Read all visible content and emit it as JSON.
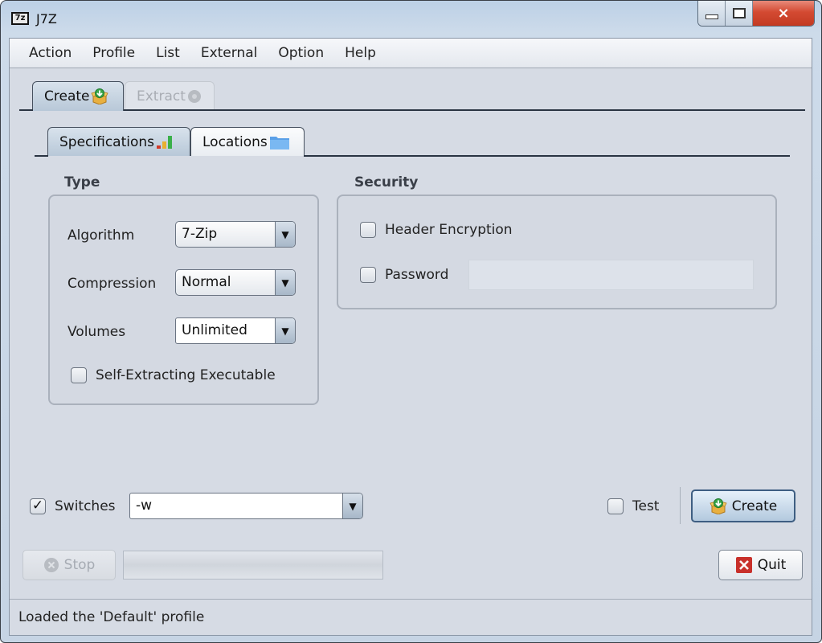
{
  "window": {
    "title": "J7Z",
    "app_icon_text": "7z",
    "controls": {
      "minimize": "minimize-icon",
      "maximize": "maximize-icon",
      "close": "×"
    }
  },
  "menubar": {
    "items": [
      {
        "label": "Action"
      },
      {
        "label": "Profile"
      },
      {
        "label": "List"
      },
      {
        "label": "External"
      },
      {
        "label": "Option"
      },
      {
        "label": "Help"
      }
    ]
  },
  "main_tabs": [
    {
      "label": "Create",
      "icon": "create-archive-icon",
      "state": "active"
    },
    {
      "label": "Extract",
      "icon": "extract-archive-icon",
      "state": "disabled"
    }
  ],
  "sub_tabs": [
    {
      "label": "Specifications",
      "icon": "signal-bars-icon",
      "state": "active"
    },
    {
      "label": "Locations",
      "icon": "folder-icon",
      "state": "inactive"
    }
  ],
  "type_section": {
    "title": "Type",
    "algorithm": {
      "label": "Algorithm",
      "value": "7-Zip"
    },
    "compression": {
      "label": "Compression",
      "value": "Normal"
    },
    "volumes": {
      "label": "Volumes",
      "value": "Unlimited"
    },
    "self_extracting": {
      "label": "Self-Extracting Executable",
      "checked": false
    }
  },
  "security_section": {
    "title": "Security",
    "header_encryption": {
      "label": "Header Encryption",
      "checked": false
    },
    "password": {
      "label": "Password",
      "checked": false,
      "value": ""
    }
  },
  "bottom": {
    "switches": {
      "label": "Switches",
      "checked": true,
      "check_mark": "✓",
      "value": "-w"
    },
    "test": {
      "label": "Test",
      "checked": false
    },
    "create_button": "Create",
    "stop_button": "Stop",
    "quit_button": "Quit",
    "progress": 0
  },
  "status": {
    "text": "Loaded the 'Default' profile"
  },
  "colors": {
    "accent_border": "#3e5e82",
    "close_button": "#d44a32",
    "quit_icon": "#c8302a",
    "create_icon_green": "#3aa64a",
    "create_icon_box": "#e8b040"
  }
}
